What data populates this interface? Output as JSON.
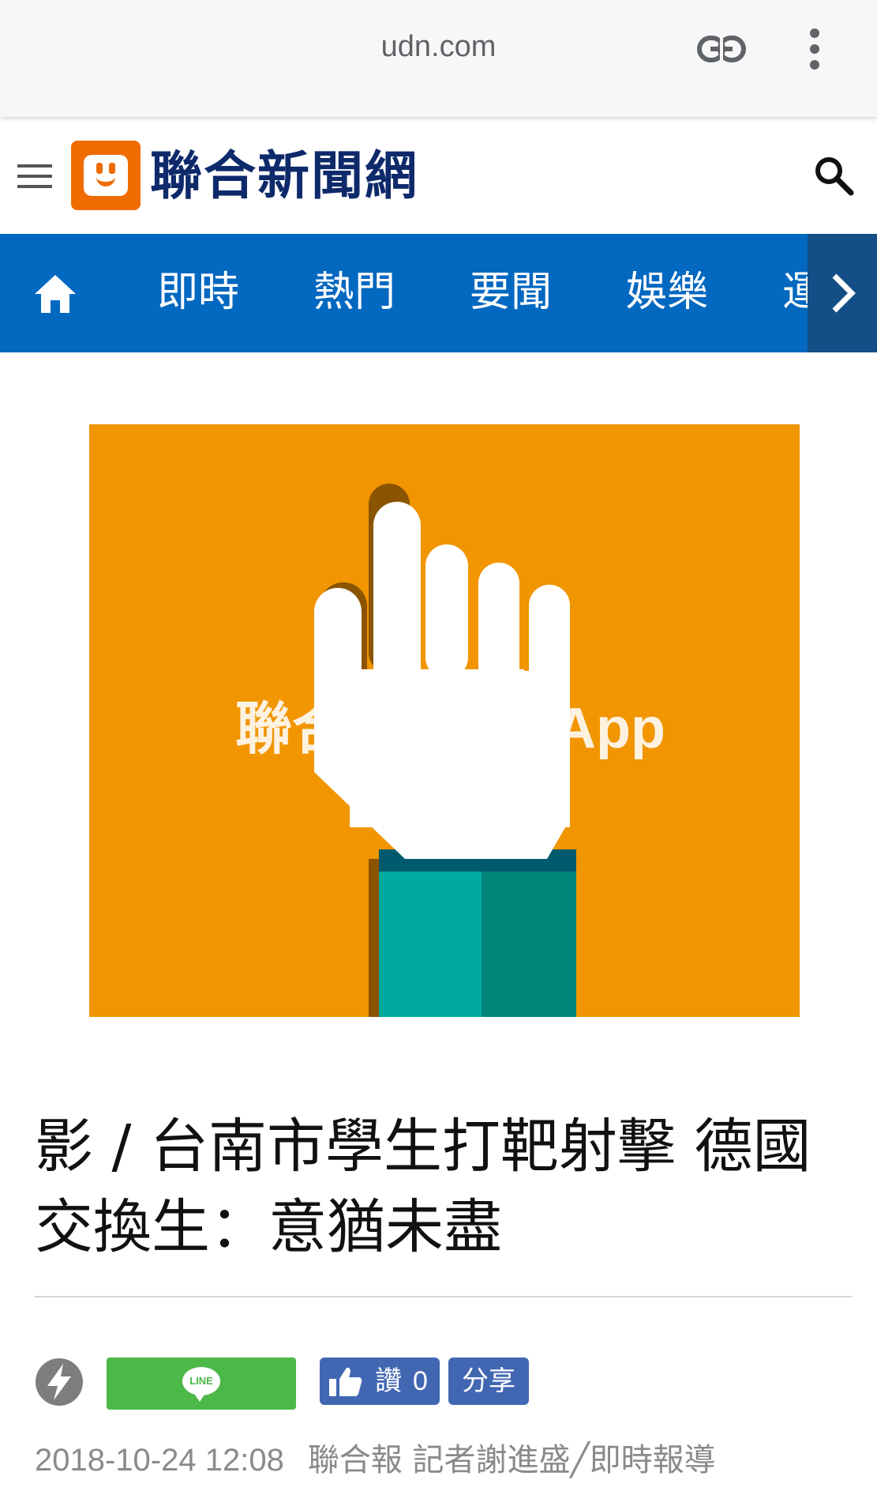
{
  "browser": {
    "url": "udn.com",
    "icons": [
      "link-icon",
      "more-vertical-icon"
    ]
  },
  "header": {
    "logo_text": "聯合新聞網",
    "icons": [
      "menu-icon",
      "search-icon"
    ],
    "brand_color": "#ef6c00",
    "title_color": "#0e2a6b"
  },
  "nav": {
    "background": "#0268c0",
    "items": [
      {
        "label": "即時"
      },
      {
        "label": "熱門"
      },
      {
        "label": "要聞"
      },
      {
        "label": "娛樂"
      },
      {
        "label": "運動"
      }
    ],
    "icons": [
      "home-icon",
      "chevron-right-icon"
    ]
  },
  "hero": {
    "text_left": "聯合",
    "text_right": "App",
    "background": "#f19500"
  },
  "article": {
    "headline": "影 / 台南市學生打靶射擊 德國交換生：意猶未盡",
    "date": "2018-10-24 12:08",
    "source": "聯合報 記者謝進盛╱即時報導"
  },
  "share": {
    "line_label": "LINE",
    "like_label": "讚",
    "like_count": "0",
    "share_label": "分享",
    "line_color": "#4cb848",
    "fb_color": "#4267b2"
  }
}
